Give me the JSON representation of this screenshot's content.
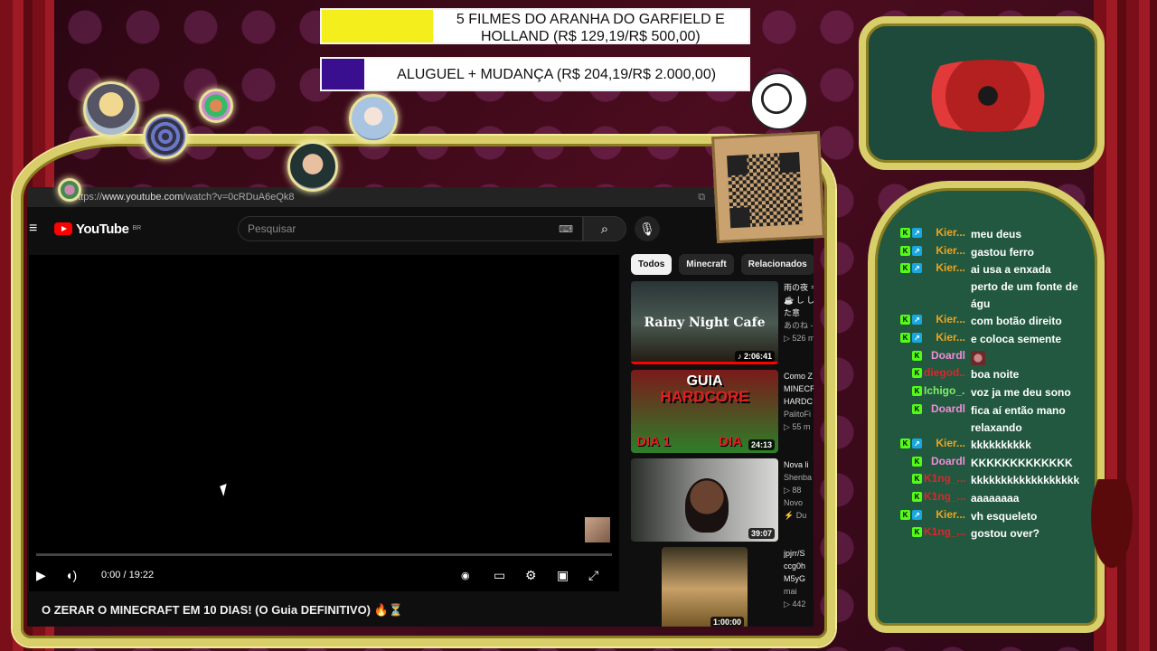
{
  "goals": [
    {
      "label": "5 FILMES DO ARANHA DO GARFIELD E HOLLAND (R$ 129,19/R$ 500,00)",
      "fill": 0.26,
      "color": "#f3ee1c"
    },
    {
      "label": "ALUGUEL + MUDANÇA (R$ 204,19/R$ 2.000,00)",
      "fill": 0.1,
      "color": "#3a0f8f"
    }
  ],
  "browser": {
    "url_prefix": "https://",
    "url_main": "www.youtube.com",
    "url_rest": "/watch?v=0cRDuA6eQk8"
  },
  "youtube": {
    "logo_text": "YouTube",
    "region": "BR",
    "search_placeholder": "Pesquisar",
    "time": "0:00 / 19:22",
    "progress": 0.0,
    "video_title": "O ZERAR O MINECRAFT EM 10 DIAS! (O Guia DEFINITIVO) 🔥⏳",
    "chips": [
      "Todos",
      "Minecraft",
      "Relacionados"
    ],
    "recommendations": [
      {
        "title": "雨の夜 ＝ ☕ し した意",
        "overlay": "Rainy Night Cafe",
        "channel": "あのね -",
        "views": "▷ 526 m",
        "duration": "♪ 2:06:41"
      },
      {
        "title": "Como Z MINECR HARDC",
        "overlay_top": "GUIA",
        "overlay_mid": "HARDCORE",
        "overlay_left": "DIA 1",
        "overlay_right": "DIA",
        "channel": "PalitoFi",
        "views": "▷ 55 m",
        "duration": "24:13"
      },
      {
        "title": "Nova li",
        "channel": "Shenba",
        "views": "▷ 88",
        "tag": "Novo",
        "extra": "⚡ Du",
        "duration": "39:07"
      },
      {
        "title": "jpjrr/S ccg0h M5yG",
        "channel": "mai",
        "views": "▷ 442",
        "duration": "1:00:00"
      }
    ]
  },
  "chat": [
    {
      "badges": [
        "k",
        "s"
      ],
      "user": "Kier...",
      "color": "#f2a31d",
      "text": "meu deus"
    },
    {
      "badges": [
        "k",
        "s"
      ],
      "user": "Kier...",
      "color": "#f2a31d",
      "text": "gastou ferro"
    },
    {
      "badges": [
        "k",
        "s"
      ],
      "user": "Kier...",
      "color": "#f2a31d",
      "text": "ai usa a enxada perto de um fonte de águ"
    },
    {
      "badges": [
        "k",
        "s"
      ],
      "user": "Kier...",
      "color": "#f2a31d",
      "text": "com botão direito"
    },
    {
      "badges": [
        "k",
        "s"
      ],
      "user": "Kier...",
      "color": "#f2a31d",
      "text": "e coloca semente"
    },
    {
      "badges": [
        "k"
      ],
      "user": "Doardl",
      "color": "#f08cd8",
      "text": "",
      "emote": "user-emote"
    },
    {
      "badges": [
        "k"
      ],
      "user": "diegod...",
      "color": "#e0242a",
      "text": "boa noite"
    },
    {
      "badges": [
        "k"
      ],
      "user": "Ichigo_...",
      "color": "#7ef06a",
      "text": "voz ja me deu sono"
    },
    {
      "badges": [
        "k"
      ],
      "user": "Doardl",
      "color": "#f08cd8",
      "text": "fica aí então mano relaxando"
    },
    {
      "badges": [
        "k",
        "s"
      ],
      "user": "Kier...",
      "color": "#f2a31d",
      "text": "kkkkkkkkkk"
    },
    {
      "badges": [
        "k"
      ],
      "user": "Doardl",
      "color": "#f08cd8",
      "text": "KKKKKKKKKKKKK"
    },
    {
      "badges": [
        "k"
      ],
      "user": "K1ng_...",
      "color": "#e0242a",
      "text": "kkkkkkkkkkkkkkkkkk"
    },
    {
      "badges": [
        "k"
      ],
      "user": "K1ng_...",
      "color": "#e0242a",
      "text": "aaaaaaaa"
    },
    {
      "badges": [
        "k",
        "s"
      ],
      "user": "Kier...",
      "color": "#f2a31d",
      "text": "vh esqueleto"
    },
    {
      "badges": [
        "k"
      ],
      "user": "K1ng_...",
      "color": "#e0242a",
      "text": "gostou over?"
    }
  ],
  "icons": {
    "menu": "hamburger-icon",
    "search": "search-icon",
    "mic": "microphone-icon",
    "keyboard": "keyboard-icon",
    "play": "play-icon",
    "volume": "volume-icon",
    "settings": "gear-icon",
    "fullscreen": "fullscreen-icon",
    "subtitles": "subtitles-icon",
    "autoplay": "autoplay-toggle-icon",
    "theater": "theater-mode-icon"
  }
}
